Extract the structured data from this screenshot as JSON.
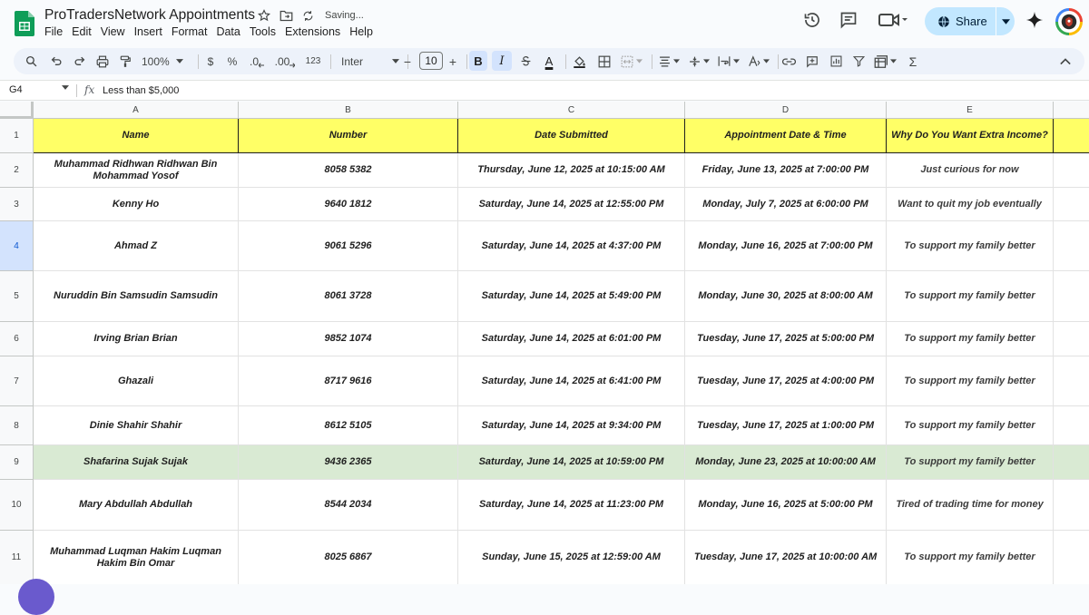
{
  "app": {
    "title": "ProTradersNetwork Appointments",
    "saving_status": "Saving...",
    "menu": [
      "File",
      "Edit",
      "View",
      "Insert",
      "Format",
      "Data",
      "Tools",
      "Extensions",
      "Help"
    ],
    "share_label": "Share"
  },
  "toolbar": {
    "zoom": "100%",
    "currency": "$",
    "percent": "%",
    "dec_decrease": ".0",
    "dec_increase": ".00",
    "number_format": "123",
    "font": "Inter",
    "font_size": "10",
    "bold": "B",
    "italic": "I",
    "text_color": "A",
    "minus": "−",
    "plus": "+"
  },
  "formula_bar": {
    "cell_ref": "G4",
    "fx": "fx",
    "content": "Less than $5,000"
  },
  "columns": [
    "A",
    "B",
    "C",
    "D",
    "E"
  ],
  "header_row": {
    "row_number": "1",
    "cells": [
      "Name",
      "Number",
      "Date Submitted",
      "Appointment Date & Time",
      "Why Do You Want Extra Income?"
    ]
  },
  "rows": [
    {
      "num": "2",
      "cells": [
        "Muhammad Ridhwan Ridhwan Bin Mohammad Yosof",
        "8058 5382",
        "Thursday, June 12, 2025 at 10:15:00 AM",
        "Friday, June 13, 2025 at 7:00:00 PM",
        "Just curious for now"
      ]
    },
    {
      "num": "3",
      "cells": [
        "Kenny Ho",
        "9640 1812",
        "Saturday, June 14, 2025 at 12:55:00 PM",
        "Monday, July 7, 2025 at 6:00:00 PM",
        "Want to quit my job eventually"
      ]
    },
    {
      "num": "4",
      "cells": [
        "Ahmad Z",
        "9061 5296",
        "Saturday, June 14, 2025 at 4:37:00 PM",
        "Monday, June 16, 2025 at 7:00:00 PM",
        "To support my family better"
      ]
    },
    {
      "num": "5",
      "cells": [
        "Nuruddin Bin Samsudin Samsudin",
        "8061 3728",
        "Saturday, June 14, 2025 at 5:49:00 PM",
        "Monday, June 30, 2025 at 8:00:00 AM",
        "To support my family better"
      ]
    },
    {
      "num": "6",
      "cells": [
        "Irving Brian Brian",
        "9852 1074",
        "Saturday, June 14, 2025 at 6:01:00 PM",
        "Tuesday, June 17, 2025 at 5:00:00 PM",
        "To support my family better"
      ]
    },
    {
      "num": "7",
      "cells": [
        "Ghazali",
        "8717 9616",
        "Saturday, June 14, 2025 at 6:41:00 PM",
        "Tuesday, June 17, 2025 at 4:00:00 PM",
        "To support my family better"
      ]
    },
    {
      "num": "8",
      "cells": [
        "Dinie Shahir Shahir",
        "8612 5105",
        "Saturday, June 14, 2025 at 9:34:00 PM",
        "Tuesday, June 17, 2025 at 1:00:00 PM",
        "To support my family better"
      ]
    },
    {
      "num": "9",
      "cells": [
        "Shafarina Sujak Sujak",
        "9436 2365",
        "Saturday, June 14, 2025 at 10:59:00 PM",
        "Monday, June 23, 2025 at 10:00:00 AM",
        "To support my family better"
      ]
    },
    {
      "num": "10",
      "cells": [
        "Mary Abdullah Abdullah",
        "8544 2034",
        "Saturday, June 14, 2025 at 11:23:00 PM",
        "Monday, June 16, 2025 at 5:00:00 PM",
        "Tired of trading time for money"
      ]
    },
    {
      "num": "11",
      "cells": [
        "Muhammad Luqman Hakim Luqman Hakim Bin Omar",
        "8025 6867",
        "Sunday, June 15, 2025 at 12:59:00 AM",
        "Tuesday, June 17, 2025 at 10:00:00 AM",
        "To support my family better"
      ]
    }
  ],
  "colors": {
    "header_fill": "#ffff66",
    "highlight_row_fill": "#d9ead3",
    "share_button": "#c2e7ff",
    "toolbar_bg": "#edf2fa",
    "selected_row_header": "#d3e3fd"
  }
}
